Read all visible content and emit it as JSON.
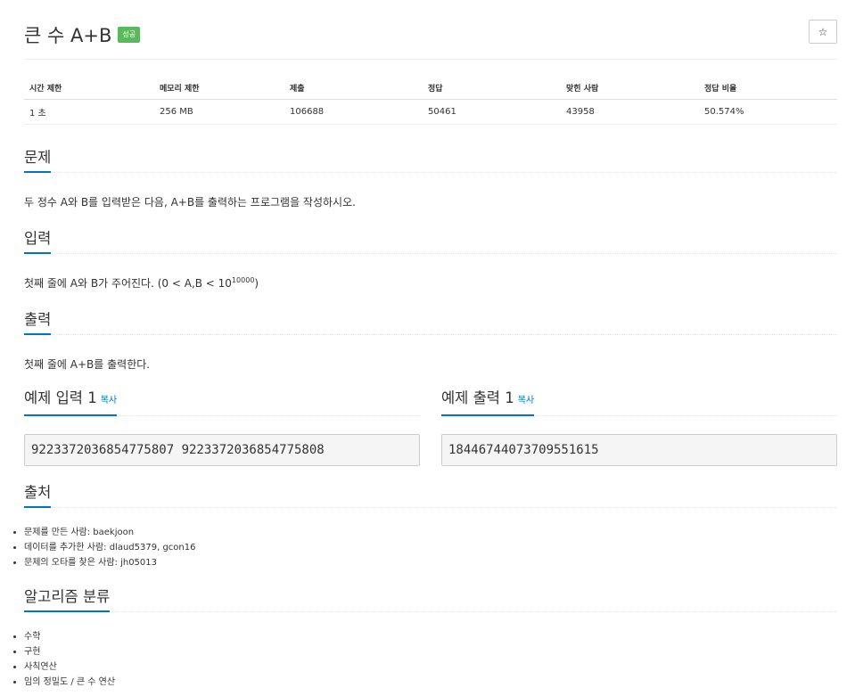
{
  "header": {
    "title": "큰 수 A+B",
    "badge": "성공",
    "star_icon": "☆"
  },
  "stats": {
    "headers": [
      "시간 제한",
      "메모리 제한",
      "제출",
      "정답",
      "맞힌 사람",
      "정답 비율"
    ],
    "values": [
      "1 초",
      "256 MB",
      "106688",
      "50461",
      "43958",
      "50.574%"
    ]
  },
  "problem": {
    "heading": "문제",
    "text": "두 정수 A와 B를 입력받은 다음, A+B를 출력하는 프로그램을 작성하시오."
  },
  "input": {
    "heading": "입력",
    "text_prefix": "첫째 줄에 A와 B가 주어진다. (0 < A,B < 10",
    "text_sup": "10000",
    "text_suffix": ")"
  },
  "output": {
    "heading": "출력",
    "text": "첫째 줄에 A+B를 출력한다."
  },
  "sample_input": {
    "heading": "예제 입력 1",
    "copy_label": "복사",
    "value": "9223372036854775807 9223372036854775808"
  },
  "sample_output": {
    "heading": "예제 출력 1",
    "copy_label": "복사",
    "value": "18446744073709551615"
  },
  "source": {
    "heading": "출처",
    "items": [
      "문제를 만든 사람: baekjoon",
      "데이터를 추가한 사람: dlaud5379, gcon16",
      "문제의 오타를 찾은 사람: jh05013"
    ]
  },
  "algorithm": {
    "heading": "알고리즘 분류",
    "items": [
      "수학",
      "구현",
      "사칙연산",
      "임의 정밀도 / 큰 수 연산"
    ]
  },
  "colors": {
    "accent": "#0076c0",
    "badge": "#5cb85c"
  }
}
